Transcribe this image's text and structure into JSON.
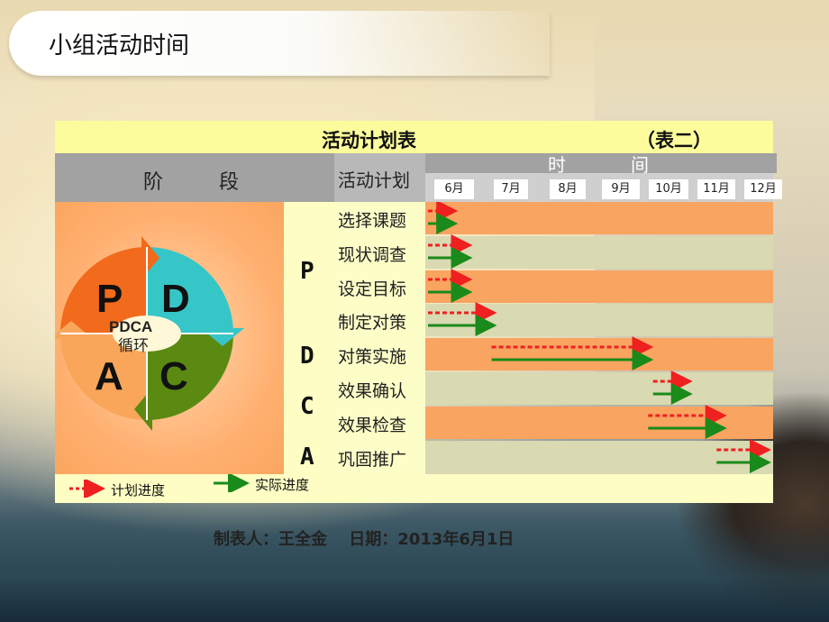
{
  "slide": {
    "title": "小组活动时间"
  },
  "table": {
    "title": "活动计划表",
    "table_no": "（表二）",
    "stage_header": "阶段",
    "activity_header": "活动计划",
    "time_header": "时间",
    "months": [
      "6月",
      "7月",
      "8月",
      "9月",
      "10月",
      "11月",
      "12月"
    ],
    "pdca_letters": [
      "P",
      "D",
      "C",
      "A"
    ],
    "activities": [
      {
        "name": "选择课题",
        "plan": [
          0.0,
          0.5
        ],
        "actual": [
          0.0,
          0.5
        ]
      },
      {
        "name": "现状调查",
        "plan": [
          0.0,
          0.8
        ],
        "actual": [
          0.0,
          0.8
        ]
      },
      {
        "name": "设定目标",
        "plan": [
          0.0,
          0.8
        ],
        "actual": [
          0.0,
          0.8
        ]
      },
      {
        "name": "制定对策",
        "plan": [
          0.0,
          1.3
        ],
        "actual": [
          0.0,
          1.3
        ]
      },
      {
        "name": "对策实施",
        "plan": [
          1.3,
          4.5
        ],
        "actual": [
          1.3,
          4.5
        ]
      },
      {
        "name": "效果确认",
        "plan": [
          4.6,
          5.3
        ],
        "actual": [
          4.6,
          5.3
        ]
      },
      {
        "name": "效果检查",
        "plan": [
          4.5,
          6.0
        ],
        "actual": [
          4.5,
          6.0
        ]
      },
      {
        "name": "巩固推广",
        "plan": [
          5.9,
          7.0
        ],
        "actual": [
          5.9,
          7.0
        ]
      }
    ],
    "legend": {
      "plan": "计划进度",
      "actual": "实际进度"
    },
    "colors": {
      "plan": "#ee2020",
      "actual": "#1a8a1a"
    }
  },
  "pdca_diagram": {
    "quadrants": [
      {
        "letter": "P",
        "color": "#f26a1b"
      },
      {
        "letter": "D",
        "color": "#36c6c8"
      },
      {
        "letter": "C",
        "color": "#5a8a12"
      },
      {
        "letter": "A",
        "color": "#f9a65a"
      }
    ],
    "center_line1": "PDCA",
    "center_line2": "循环"
  },
  "footer": {
    "maker": "制表人：王全金",
    "date": "日期：2013年6月1日"
  }
}
